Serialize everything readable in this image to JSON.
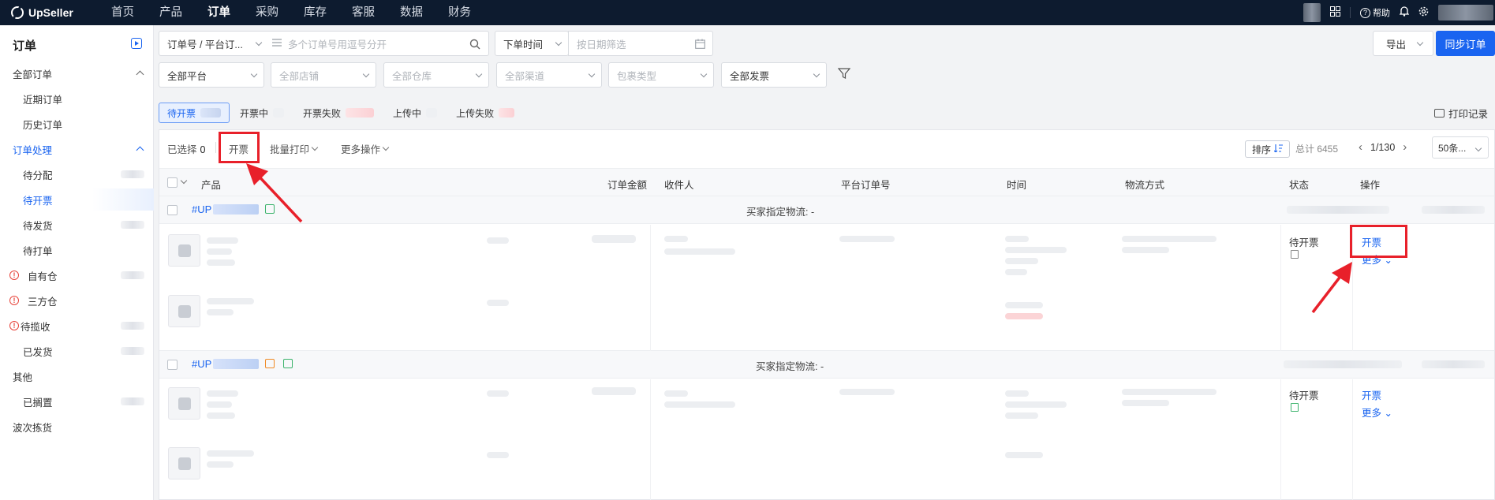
{
  "app": {
    "logo": "UpSeller"
  },
  "nav": {
    "items": [
      "首页",
      "产品",
      "订单",
      "采购",
      "库存",
      "客服",
      "数据",
      "财务"
    ],
    "active_index": 2,
    "help_label": "帮助"
  },
  "sidebar": {
    "title": "订单",
    "all_orders": "全部订单",
    "recent_orders": "近期订单",
    "history_orders": "历史订单",
    "processing": "订单处理",
    "to_assign": "待分配",
    "to_invoice": "待开票",
    "to_ship": "待发货",
    "to_print": "待打单",
    "own_warehouse": "自有仓",
    "third_warehouse": "三方仓",
    "to_collect": "待揽收",
    "shipped": "已发货",
    "other": "其他",
    "on_hold": "已搁置",
    "wave_picking": "波次拣货"
  },
  "filters": {
    "search_type": "订单号 / 平台订...",
    "search_placeholder": "多个订单号用逗号分开",
    "time_type": "下单时间",
    "date_placeholder": "按日期筛选",
    "platform": "全部平台",
    "shop": "全部店铺",
    "warehouse": "全部仓库",
    "channel": "全部渠道",
    "package_type": "包裹类型",
    "invoice": "全部发票"
  },
  "header_buttons": {
    "export": "导出",
    "sync": "同步订单"
  },
  "status_tabs": [
    "待开票",
    "开票中",
    "开票失败",
    "上传中",
    "上传失败"
  ],
  "print_log": "打印记录",
  "toolbar": {
    "selected_label": "已选择",
    "selected_count": "0",
    "invoice_btn": "开票",
    "batch_print": "批量打印",
    "more_ops": "更多操作",
    "sort": "排序",
    "total": "总计 6455",
    "page": "1/130",
    "page_size": "50条..."
  },
  "columns": {
    "product": "产品",
    "amount": "订单金额",
    "recipient": "收件人",
    "platform_no": "平台订单号",
    "time": "时间",
    "logistics": "物流方式",
    "status": "状态",
    "action": "操作"
  },
  "orders": [
    {
      "id_prefix": "#UP",
      "buyer_logistics": "买家指定物流: -",
      "status": "待开票",
      "action_primary": "开票",
      "action_more": "更多"
    },
    {
      "id_prefix": "#UP",
      "buyer_logistics": "买家指定物流: -",
      "status": "待开票",
      "action_primary": "开票",
      "action_more": "更多"
    }
  ],
  "colors": {
    "accent": "#1a64f0",
    "nav_bg": "#0d1b2f",
    "annotation": "#e8202a"
  }
}
